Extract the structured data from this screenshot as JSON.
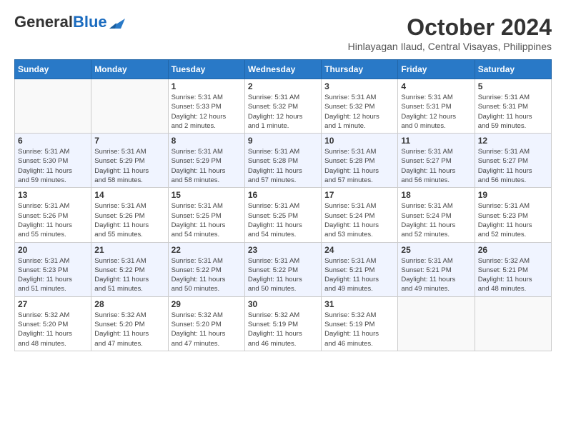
{
  "header": {
    "logo_general": "General",
    "logo_blue": "Blue",
    "month_title": "October 2024",
    "location": "Hinlayagan Ilaud, Central Visayas, Philippines"
  },
  "days_of_week": [
    "Sunday",
    "Monday",
    "Tuesday",
    "Wednesday",
    "Thursday",
    "Friday",
    "Saturday"
  ],
  "weeks": [
    [
      {
        "day": "",
        "info": ""
      },
      {
        "day": "",
        "info": ""
      },
      {
        "day": "1",
        "info": "Sunrise: 5:31 AM\nSunset: 5:33 PM\nDaylight: 12 hours\nand 2 minutes."
      },
      {
        "day": "2",
        "info": "Sunrise: 5:31 AM\nSunset: 5:32 PM\nDaylight: 12 hours\nand 1 minute."
      },
      {
        "day": "3",
        "info": "Sunrise: 5:31 AM\nSunset: 5:32 PM\nDaylight: 12 hours\nand 1 minute."
      },
      {
        "day": "4",
        "info": "Sunrise: 5:31 AM\nSunset: 5:31 PM\nDaylight: 12 hours\nand 0 minutes."
      },
      {
        "day": "5",
        "info": "Sunrise: 5:31 AM\nSunset: 5:31 PM\nDaylight: 11 hours\nand 59 minutes."
      }
    ],
    [
      {
        "day": "6",
        "info": "Sunrise: 5:31 AM\nSunset: 5:30 PM\nDaylight: 11 hours\nand 59 minutes."
      },
      {
        "day": "7",
        "info": "Sunrise: 5:31 AM\nSunset: 5:29 PM\nDaylight: 11 hours\nand 58 minutes."
      },
      {
        "day": "8",
        "info": "Sunrise: 5:31 AM\nSunset: 5:29 PM\nDaylight: 11 hours\nand 58 minutes."
      },
      {
        "day": "9",
        "info": "Sunrise: 5:31 AM\nSunset: 5:28 PM\nDaylight: 11 hours\nand 57 minutes."
      },
      {
        "day": "10",
        "info": "Sunrise: 5:31 AM\nSunset: 5:28 PM\nDaylight: 11 hours\nand 57 minutes."
      },
      {
        "day": "11",
        "info": "Sunrise: 5:31 AM\nSunset: 5:27 PM\nDaylight: 11 hours\nand 56 minutes."
      },
      {
        "day": "12",
        "info": "Sunrise: 5:31 AM\nSunset: 5:27 PM\nDaylight: 11 hours\nand 56 minutes."
      }
    ],
    [
      {
        "day": "13",
        "info": "Sunrise: 5:31 AM\nSunset: 5:26 PM\nDaylight: 11 hours\nand 55 minutes."
      },
      {
        "day": "14",
        "info": "Sunrise: 5:31 AM\nSunset: 5:26 PM\nDaylight: 11 hours\nand 55 minutes."
      },
      {
        "day": "15",
        "info": "Sunrise: 5:31 AM\nSunset: 5:25 PM\nDaylight: 11 hours\nand 54 minutes."
      },
      {
        "day": "16",
        "info": "Sunrise: 5:31 AM\nSunset: 5:25 PM\nDaylight: 11 hours\nand 54 minutes."
      },
      {
        "day": "17",
        "info": "Sunrise: 5:31 AM\nSunset: 5:24 PM\nDaylight: 11 hours\nand 53 minutes."
      },
      {
        "day": "18",
        "info": "Sunrise: 5:31 AM\nSunset: 5:24 PM\nDaylight: 11 hours\nand 52 minutes."
      },
      {
        "day": "19",
        "info": "Sunrise: 5:31 AM\nSunset: 5:23 PM\nDaylight: 11 hours\nand 52 minutes."
      }
    ],
    [
      {
        "day": "20",
        "info": "Sunrise: 5:31 AM\nSunset: 5:23 PM\nDaylight: 11 hours\nand 51 minutes."
      },
      {
        "day": "21",
        "info": "Sunrise: 5:31 AM\nSunset: 5:22 PM\nDaylight: 11 hours\nand 51 minutes."
      },
      {
        "day": "22",
        "info": "Sunrise: 5:31 AM\nSunset: 5:22 PM\nDaylight: 11 hours\nand 50 minutes."
      },
      {
        "day": "23",
        "info": "Sunrise: 5:31 AM\nSunset: 5:22 PM\nDaylight: 11 hours\nand 50 minutes."
      },
      {
        "day": "24",
        "info": "Sunrise: 5:31 AM\nSunset: 5:21 PM\nDaylight: 11 hours\nand 49 minutes."
      },
      {
        "day": "25",
        "info": "Sunrise: 5:31 AM\nSunset: 5:21 PM\nDaylight: 11 hours\nand 49 minutes."
      },
      {
        "day": "26",
        "info": "Sunrise: 5:32 AM\nSunset: 5:21 PM\nDaylight: 11 hours\nand 48 minutes."
      }
    ],
    [
      {
        "day": "27",
        "info": "Sunrise: 5:32 AM\nSunset: 5:20 PM\nDaylight: 11 hours\nand 48 minutes."
      },
      {
        "day": "28",
        "info": "Sunrise: 5:32 AM\nSunset: 5:20 PM\nDaylight: 11 hours\nand 47 minutes."
      },
      {
        "day": "29",
        "info": "Sunrise: 5:32 AM\nSunset: 5:20 PM\nDaylight: 11 hours\nand 47 minutes."
      },
      {
        "day": "30",
        "info": "Sunrise: 5:32 AM\nSunset: 5:19 PM\nDaylight: 11 hours\nand 46 minutes."
      },
      {
        "day": "31",
        "info": "Sunrise: 5:32 AM\nSunset: 5:19 PM\nDaylight: 11 hours\nand 46 minutes."
      },
      {
        "day": "",
        "info": ""
      },
      {
        "day": "",
        "info": ""
      }
    ]
  ]
}
